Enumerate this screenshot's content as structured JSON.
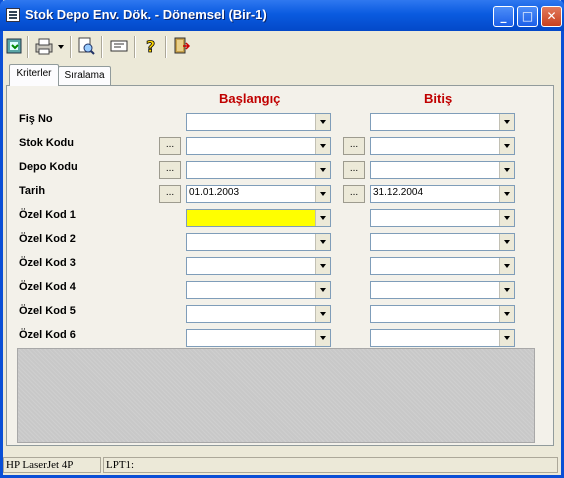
{
  "window": {
    "title": "Stok Depo Env. Dök. - Dönemsel (Bir-1)",
    "minimize": "_",
    "maximize": "□",
    "close": "✕"
  },
  "toolbar": {
    "items": [
      "exit-icon",
      "print-icon",
      "preview-icon",
      "export-icon",
      "help-icon",
      "door-exit-icon"
    ]
  },
  "tabs": [
    "Kriterler",
    "Sıralama"
  ],
  "headers": {
    "start": "Başlangıç",
    "end": "Bitiş"
  },
  "dots_label": "...",
  "rows": [
    {
      "label": "Fiş No",
      "start": "",
      "end": ""
    },
    {
      "label": "Stok Kodu",
      "start": "",
      "end": ""
    },
    {
      "label": "Depo Kodu",
      "start": "",
      "end": ""
    },
    {
      "label": "Tarih",
      "start": "01.01.2003",
      "end": "31.12.2004"
    },
    {
      "label": "Özel Kod 1",
      "start": "",
      "end": ""
    },
    {
      "label": "Özel Kod 2",
      "start": "",
      "end": ""
    },
    {
      "label": "Özel Kod 3",
      "start": "",
      "end": ""
    },
    {
      "label": "Özel Kod 4",
      "start": "",
      "end": ""
    },
    {
      "label": "Özel Kod 5",
      "start": "",
      "end": ""
    },
    {
      "label": "Özel Kod 6",
      "start": "",
      "end": ""
    }
  ],
  "status": {
    "printer": "HP LaserJet 4P",
    "port": "LPT1:"
  },
  "colors": {
    "header_red": "#c00000",
    "highlight_yellow": "#ffff00"
  }
}
